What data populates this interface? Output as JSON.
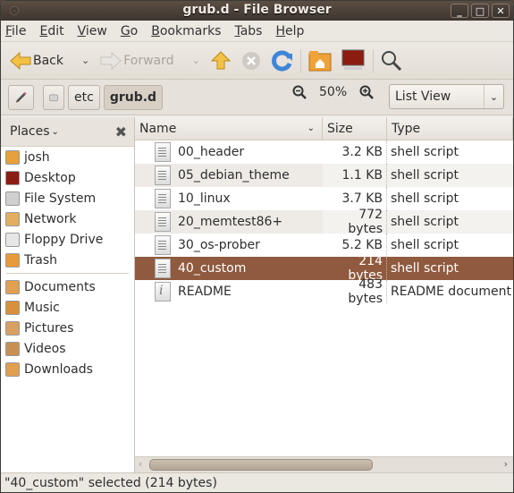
{
  "window": {
    "title": "grub.d - File Browser"
  },
  "menubar": {
    "items": [
      {
        "label": "File",
        "mnemonic": "F",
        "rest": "ile"
      },
      {
        "label": "Edit",
        "mnemonic": "E",
        "rest": "dit"
      },
      {
        "label": "View",
        "mnemonic": "V",
        "rest": "iew"
      },
      {
        "label": "Go",
        "mnemonic": "G",
        "rest": "o"
      },
      {
        "label": "Bookmarks",
        "mnemonic": "B",
        "rest": "ookmarks"
      },
      {
        "label": "Tabs",
        "mnemonic": "T",
        "rest": "abs"
      },
      {
        "label": "Help",
        "mnemonic": "H",
        "rest": "elp"
      }
    ]
  },
  "toolbar": {
    "back_label": "Back",
    "forward_label": "Forward",
    "icons": {
      "back": "back-arrow-icon",
      "forward": "forward-arrow-icon",
      "up": "up-arrow-icon",
      "stop": "stop-icon",
      "reload": "reload-icon",
      "home": "home-folder-icon",
      "computer": "computer-icon",
      "search": "search-icon"
    }
  },
  "location": {
    "path": [
      "etc",
      "grub.d"
    ],
    "zoom": "50%",
    "view_mode": "List View"
  },
  "sidebar": {
    "header": "Places",
    "items": [
      {
        "label": "josh",
        "icon": "home-folder-icon",
        "color": "#e8a03c"
      },
      {
        "label": "Desktop",
        "icon": "desktop-icon",
        "color": "#8b1e14"
      },
      {
        "label": "File System",
        "icon": "harddisk-icon",
        "color": "#cfcfcf"
      },
      {
        "label": "Network",
        "icon": "network-icon",
        "color": "#e0b060"
      },
      {
        "label": "Floppy Drive",
        "icon": "floppy-icon",
        "color": "#e6e6e6"
      },
      {
        "label": "Trash",
        "icon": "trash-icon",
        "color": "#e89a3a"
      }
    ],
    "bookmarks": [
      {
        "label": "Documents",
        "icon": "documents-folder-icon",
        "color": "#e0a050"
      },
      {
        "label": "Music",
        "icon": "music-folder-icon",
        "color": "#d8903c"
      },
      {
        "label": "Pictures",
        "icon": "pictures-folder-icon",
        "color": "#d8a060"
      },
      {
        "label": "Videos",
        "icon": "videos-folder-icon",
        "color": "#c89050"
      },
      {
        "label": "Downloads",
        "icon": "downloads-folder-icon",
        "color": "#e0a050"
      }
    ]
  },
  "file_list": {
    "columns": [
      "Name",
      "Size",
      "Type"
    ],
    "rows": [
      {
        "name": "00_header",
        "size": "3.2 KB",
        "type": "shell script",
        "icon": "script-file-icon"
      },
      {
        "name": "05_debian_theme",
        "size": "1.1 KB",
        "type": "shell script",
        "icon": "script-file-icon"
      },
      {
        "name": "10_linux",
        "size": "3.7 KB",
        "type": "shell script",
        "icon": "script-file-icon"
      },
      {
        "name": "20_memtest86+",
        "size": "772 bytes",
        "type": "shell script",
        "icon": "script-file-icon"
      },
      {
        "name": "30_os-prober",
        "size": "5.2 KB",
        "type": "shell script",
        "icon": "script-file-icon"
      },
      {
        "name": "40_custom",
        "size": "214 bytes",
        "type": "shell script",
        "icon": "script-file-icon",
        "selected": true
      },
      {
        "name": "README",
        "size": "483 bytes",
        "type": "README document",
        "icon": "info-file-icon"
      }
    ]
  },
  "status": "\"40_custom\" selected (214 bytes)",
  "colors": {
    "selection": "#8f5a3e",
    "titlebar": "#3e3530"
  }
}
